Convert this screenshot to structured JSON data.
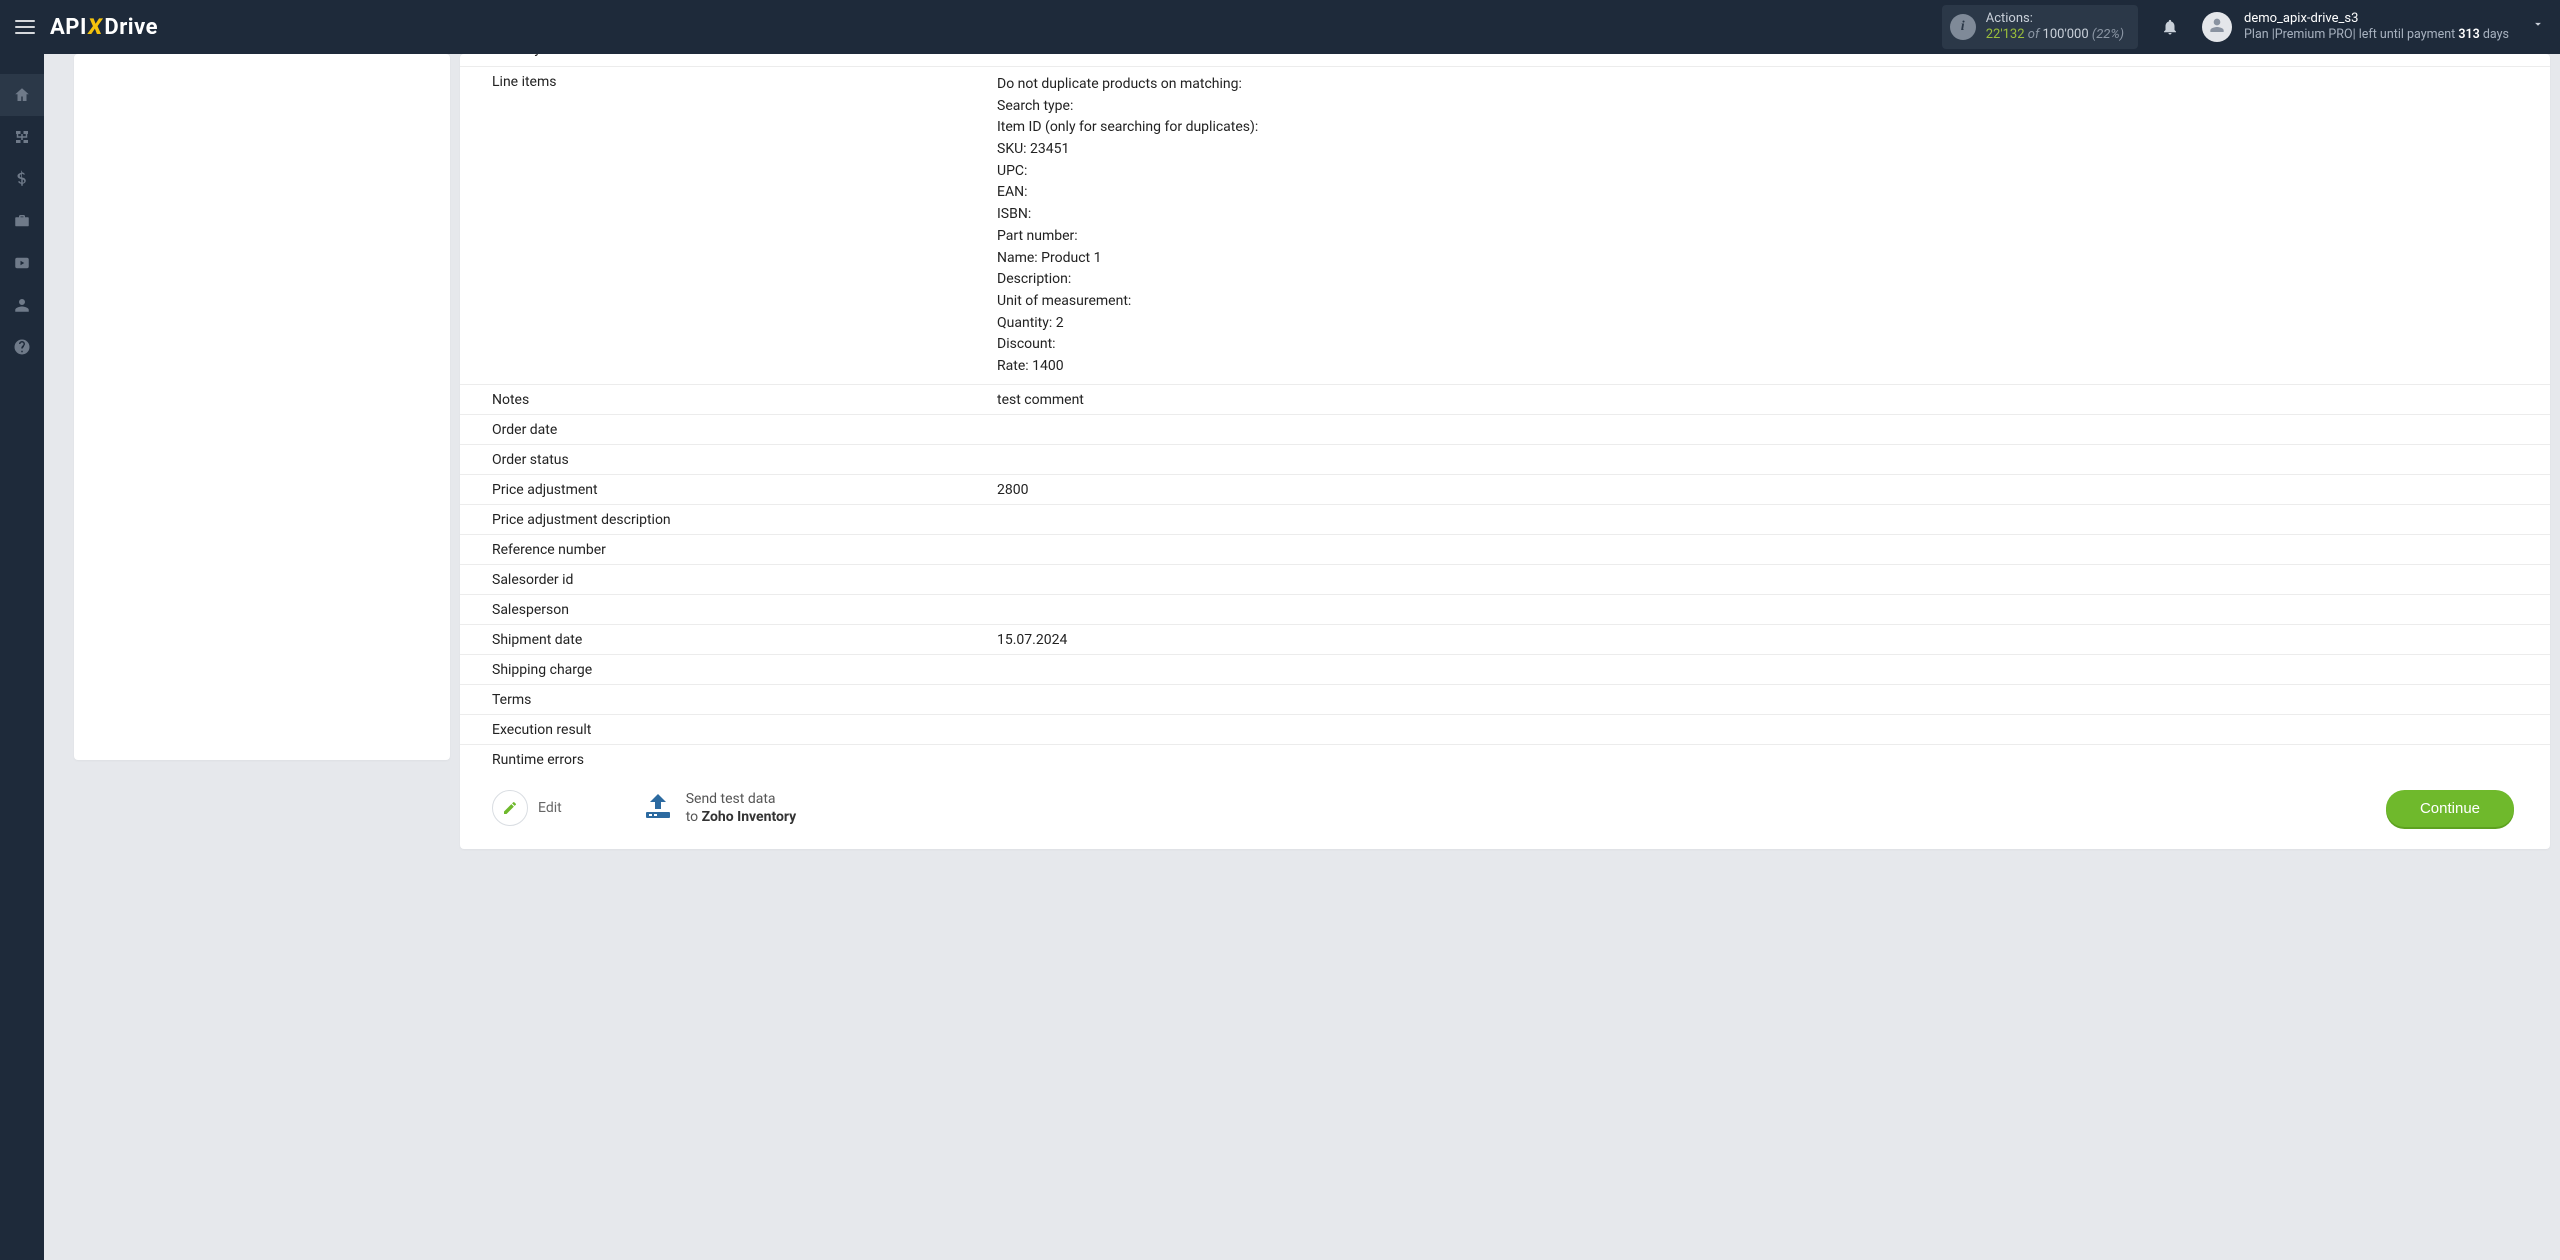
{
  "header": {
    "logo_api": "API",
    "logo_x": "X",
    "logo_drive": "Drive",
    "actions_label": "Actions:",
    "actions_count": "22'132",
    "actions_of": "of",
    "actions_total": "100'000",
    "actions_pct": "(22%)"
  },
  "user": {
    "name": "demo_apix-drive_s3",
    "plan_prefix": "Plan |",
    "plan_name": "Premium PRO",
    "plan_mid": "| left until payment ",
    "plan_days_num": "313",
    "plan_days_suffix": " days"
  },
  "sidebar": {
    "items": [
      {
        "name": "home-icon"
      },
      {
        "name": "connections-icon"
      },
      {
        "name": "billing-icon"
      },
      {
        "name": "briefcase-icon"
      },
      {
        "name": "youtube-icon"
      },
      {
        "name": "account-icon"
      },
      {
        "name": "help-icon"
      }
    ]
  },
  "rows": [
    {
      "label": "Delivery method",
      "value": ""
    },
    {
      "label": "Line items",
      "value_lines": [
        "Do not duplicate products on matching:",
        "Search type:",
        "Item ID (only for searching for duplicates):",
        "SKU: 23451",
        "UPC:",
        "EAN:",
        "ISBN:",
        "Part number:",
        "Name: Product 1",
        "Description:",
        "Unit of measurement:",
        "Quantity: 2",
        "Discount:",
        "Rate: 1400"
      ]
    },
    {
      "label": "Notes",
      "value": "test comment"
    },
    {
      "label": "Order date",
      "value": ""
    },
    {
      "label": "Order status",
      "value": ""
    },
    {
      "label": "Price adjustment",
      "value": "2800"
    },
    {
      "label": "Price adjustment description",
      "value": ""
    },
    {
      "label": "Reference number",
      "value": ""
    },
    {
      "label": "Salesorder id",
      "value": ""
    },
    {
      "label": "Salesperson",
      "value": ""
    },
    {
      "label": "Shipment date",
      "value": "15.07.2024"
    },
    {
      "label": "Shipping charge",
      "value": ""
    },
    {
      "label": "Terms",
      "value": ""
    },
    {
      "label": "Execution result",
      "value": ""
    },
    {
      "label": "Runtime errors",
      "value": ""
    }
  ],
  "actions": {
    "edit": "Edit",
    "send_line1": "Send test data",
    "send_line2_prefix": "to ",
    "send_line2_target": "Zoho Inventory",
    "continue": "Continue"
  }
}
